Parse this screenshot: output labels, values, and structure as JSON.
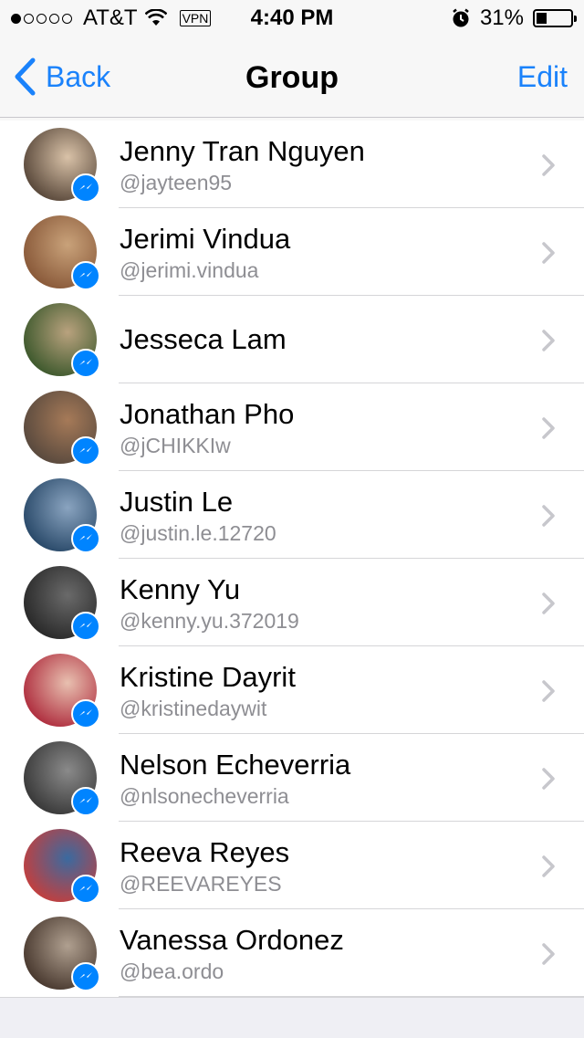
{
  "status_bar": {
    "carrier": "AT&T",
    "vpn": "VPN",
    "time": "4:40 PM",
    "battery": "31%",
    "battery_level": 0.31,
    "signal_bars": 1
  },
  "nav": {
    "back_label": "Back",
    "title": "Group",
    "edit_label": "Edit"
  },
  "colors": {
    "accent": "#1a82fb",
    "messenger_badge": "#0084ff"
  },
  "contacts": [
    {
      "name": "Jenny Tran Nguyen",
      "handle": "@jayteen95",
      "avatar_colors": [
        "#5b4a3c",
        "#d9c2a8"
      ]
    },
    {
      "name": "Jerimi Vindua",
      "handle": "@jerimi.vindua",
      "avatar_colors": [
        "#8a5a3a",
        "#c9a27a"
      ]
    },
    {
      "name": "Jesseca Lam",
      "handle": "",
      "avatar_colors": [
        "#3f5a2e",
        "#b9a27e"
      ]
    },
    {
      "name": "Jonathan Pho",
      "handle": "@jCHIKKIw",
      "avatar_colors": [
        "#5a4a3e",
        "#a67a58"
      ]
    },
    {
      "name": "Justin Le",
      "handle": "@justin.le.12720",
      "avatar_colors": [
        "#2a4a6a",
        "#8aa4c0"
      ]
    },
    {
      "name": "Kenny Yu",
      "handle": "@kenny.yu.372019",
      "avatar_colors": [
        "#2a2a2a",
        "#6a6a6a"
      ]
    },
    {
      "name": "Kristine Dayrit",
      "handle": "@kristinedaywit",
      "avatar_colors": [
        "#b03040",
        "#e8c0b0"
      ]
    },
    {
      "name": "Nelson Echeverria",
      "handle": "@nlsonecheverria",
      "avatar_colors": [
        "#3a3a3a",
        "#8a8a8a"
      ]
    },
    {
      "name": "Reeva Reyes",
      "handle": "@REEVAREYES",
      "avatar_colors": [
        "#c04040",
        "#3a6aa0"
      ]
    },
    {
      "name": "Vanessa Ordonez",
      "handle": "@bea.ordo",
      "avatar_colors": [
        "#4a3a30",
        "#b0a090"
      ]
    }
  ]
}
